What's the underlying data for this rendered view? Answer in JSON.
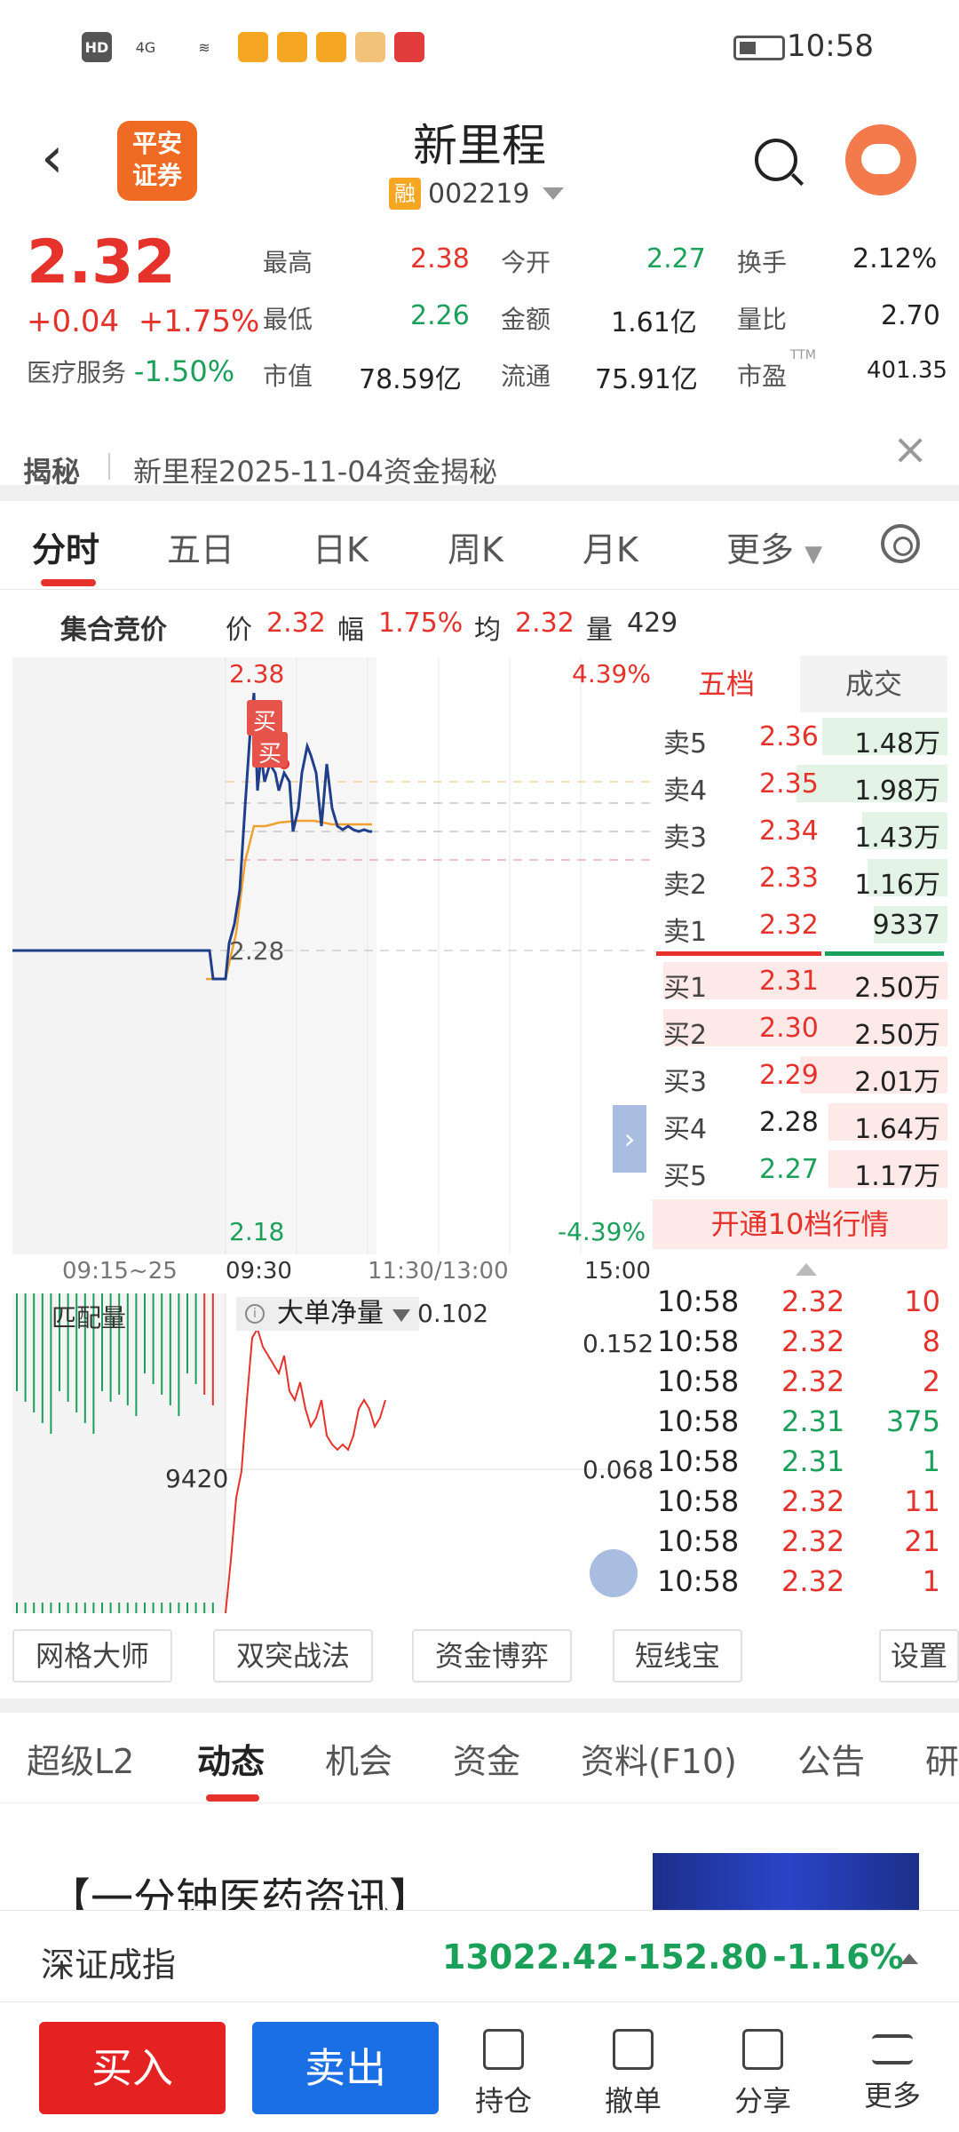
{
  "status_bar": {
    "time": "10:58",
    "hd": "HD",
    "signal": "4G"
  },
  "header": {
    "back": "‹",
    "logo": "平安\n证券",
    "title": "新里程",
    "rong": "融",
    "code": "002219"
  },
  "quote": {
    "price": "2.32",
    "change": "+0.04",
    "change_pct": "+1.75%",
    "sector_name": "医疗服务",
    "sector_pct": "-1.50%",
    "rows": [
      [
        {
          "label": "最高",
          "value": "2.38"
        },
        {
          "label": "今开",
          "value": "2.27"
        },
        {
          "label": "换手",
          "value": "2.12%"
        }
      ],
      [
        {
          "label": "最低",
          "value": "2.26"
        },
        {
          "label": "金额",
          "value": "1.61亿"
        },
        {
          "label": "量比",
          "value": "2.70"
        }
      ],
      [
        {
          "label": "市值",
          "value": "78.59亿"
        },
        {
          "label": "流通",
          "value": "75.91亿"
        },
        {
          "label": "市盈",
          "value": "401.35"
        }
      ]
    ],
    "ttm": "TTM"
  },
  "banner": {
    "tag": "揭秘",
    "text": "新里程2025-11-04资金揭秘",
    "close": "×"
  },
  "tabs": [
    "分时",
    "五日",
    "日K",
    "周K",
    "月K",
    "更多"
  ],
  "auction": {
    "label": "集合竞价",
    "price_label": "价",
    "price": "2.32",
    "pct_label": "幅",
    "pct": "1.75%",
    "avg_label": "均",
    "avg": "2.32",
    "vol_label": "量",
    "vol": "429"
  },
  "chart_labels": {
    "top_price": "2.38",
    "top_pct": "4.39%",
    "mid_price": "2.28",
    "bottom_price": "2.18",
    "bottom_pct": "-4.39%",
    "buy1": "买",
    "buy2": "买"
  },
  "time_axis": [
    "09:15~25",
    "09:30",
    "11:30/13:00",
    "15:00"
  ],
  "book": {
    "tab_active": "五档",
    "tab_other": "成交",
    "asks": [
      {
        "label": "卖5",
        "price": "2.36",
        "vol": "1.48万",
        "fill": 0.44
      },
      {
        "label": "卖4",
        "price": "2.35",
        "vol": "1.98万",
        "fill": 0.53
      },
      {
        "label": "卖3",
        "price": "2.34",
        "vol": "1.43万",
        "fill": 0.3
      },
      {
        "label": "卖2",
        "price": "2.33",
        "vol": "1.16万",
        "fill": 0.28
      },
      {
        "label": "卖1",
        "price": "2.32",
        "vol": "9337",
        "fill": 0.26
      }
    ],
    "bids": [
      {
        "label": "买1",
        "price": "2.31",
        "vol": "2.50万",
        "fill": 1.0
      },
      {
        "label": "买2",
        "price": "2.30",
        "vol": "2.50万",
        "fill": 1.0
      },
      {
        "label": "买3",
        "price": "2.29",
        "vol": "2.01万",
        "fill": 0.52
      },
      {
        "label": "买4",
        "price": "2.28",
        "vol": "1.64万",
        "fill": 0.42
      },
      {
        "label": "买5",
        "price": "2.27",
        "vol": "1.17万",
        "fill": 0.42
      }
    ],
    "open10": "开通10档行情"
  },
  "volume_chart": {
    "label": "匹配量",
    "indicator": "大单净量",
    "indicator_value": "0.102",
    "top": "0.152",
    "mid": "0.068",
    "vol_label": "9420"
  },
  "trades": [
    {
      "time": "10:58",
      "price": "2.32",
      "vol": "10",
      "color": "#e5322b"
    },
    {
      "time": "10:58",
      "price": "2.32",
      "vol": "8",
      "color": "#e5322b"
    },
    {
      "time": "10:58",
      "price": "2.32",
      "vol": "2",
      "color": "#e5322b"
    },
    {
      "time": "10:58",
      "price": "2.31",
      "vol": "375",
      "color": "#1ba05a"
    },
    {
      "time": "10:58",
      "price": "2.31",
      "vol": "1",
      "color": "#1ba05a"
    },
    {
      "time": "10:58",
      "price": "2.32",
      "vol": "11",
      "color": "#e5322b"
    },
    {
      "time": "10:58",
      "price": "2.32",
      "vol": "21",
      "color": "#e5322b"
    },
    {
      "time": "10:58",
      "price": "2.32",
      "vol": "1",
      "color": "#e5322b"
    }
  ],
  "tools": [
    "网格大师",
    "双突战法",
    "资金博弈",
    "短线宝",
    "设置"
  ],
  "tabs2": [
    "超级L2",
    "动态",
    "机会",
    "资金",
    "资料(F10)",
    "公告",
    "研"
  ],
  "news": {
    "title": "【一分钟医药资讯】"
  },
  "index": {
    "name": "深证成指",
    "value": "13022.42",
    "change": "-152.80",
    "pct": "-1.16%"
  },
  "bottom": {
    "buy": "买入",
    "sell": "卖出",
    "hold": "持仓",
    "cancel": "撤单",
    "share": "分享",
    "more": "更多"
  },
  "colors": {
    "red": "#e5322b",
    "green": "#1ba05a",
    "blue": "#1b6fe5",
    "orange": "#ef6a22"
  }
}
